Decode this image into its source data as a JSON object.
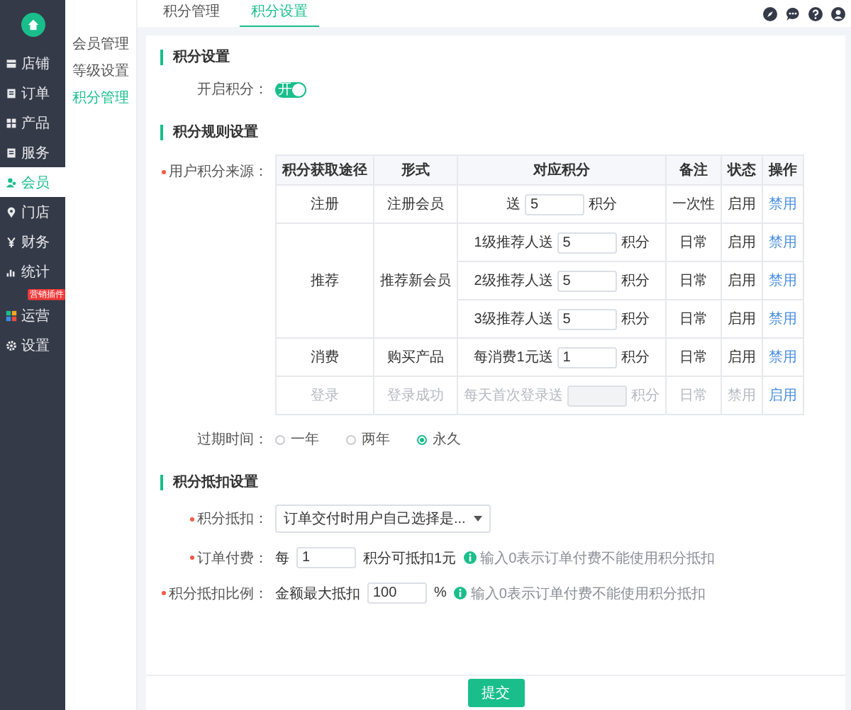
{
  "sidebar": {
    "items": [
      {
        "label": "店铺",
        "selected": false
      },
      {
        "label": "订单",
        "selected": false
      },
      {
        "label": "产品",
        "selected": false
      },
      {
        "label": "服务",
        "selected": false
      },
      {
        "label": "会员",
        "selected": true
      },
      {
        "label": "门店",
        "selected": false
      },
      {
        "label": "财务",
        "selected": false
      },
      {
        "label": "统计",
        "selected": false
      },
      {
        "label": "运营",
        "selected": false,
        "badge": "营销插件"
      },
      {
        "label": "设置",
        "selected": false
      }
    ]
  },
  "subnav": {
    "items": [
      {
        "label": "会员管理",
        "selected": false
      },
      {
        "label": "等级设置",
        "selected": false
      },
      {
        "label": "积分管理",
        "selected": true
      }
    ]
  },
  "tabs": [
    {
      "label": "积分管理",
      "selected": false
    },
    {
      "label": "积分设置",
      "selected": true
    }
  ],
  "sections": [
    {
      "title": "积分设置"
    },
    {
      "title": "积分规则设置"
    },
    {
      "title": "积分抵扣设置"
    }
  ],
  "enable": {
    "label": "开启积分：",
    "on": true,
    "text": "开"
  },
  "rules": {
    "label": "用户积分来源：",
    "required": true,
    "columns": [
      "积分获取途径",
      "形式",
      "对应积分",
      "备注",
      "状态",
      "操作"
    ],
    "groups": [
      {
        "source": "注册",
        "form": "注册会员",
        "disabled": false,
        "items": [
          {
            "prefix": "送",
            "value": "5",
            "unit": "积分",
            "note": "一次性",
            "status": "启用",
            "action": "禁用"
          }
        ]
      },
      {
        "source": "推荐",
        "form": "推荐新会员",
        "disabled": false,
        "items": [
          {
            "prefix": "1级推荐人送",
            "value": "5",
            "unit": "积分",
            "note": "日常",
            "status": "启用",
            "action": "禁用"
          },
          {
            "prefix": "2级推荐人送",
            "value": "5",
            "unit": "积分",
            "note": "日常",
            "status": "启用",
            "action": "禁用"
          },
          {
            "prefix": "3级推荐人送",
            "value": "5",
            "unit": "积分",
            "note": "日常",
            "status": "启用",
            "action": "禁用"
          }
        ]
      },
      {
        "source": "消费",
        "form": "购买产品",
        "disabled": false,
        "items": [
          {
            "prefix": "每消费1元送",
            "value": "1",
            "unit": "积分",
            "note": "日常",
            "status": "启用",
            "action": "禁用"
          }
        ]
      },
      {
        "source": "登录",
        "form": "登录成功",
        "disabled": true,
        "items": [
          {
            "prefix": "每天首次登录送",
            "unit": "积分",
            "note": "日常",
            "status": "禁用",
            "action": "启用"
          }
        ]
      }
    ]
  },
  "expiry": {
    "label": "过期时间：",
    "options": [
      {
        "label": "一年",
        "selected": false
      },
      {
        "label": "两年",
        "selected": false
      },
      {
        "label": "永久",
        "selected": true
      }
    ]
  },
  "deduction": [
    {
      "kind": "select",
      "label": "积分抵扣：",
      "required": true,
      "value": "订单交付时用户自己选择是..."
    },
    {
      "kind": "input",
      "label": "订单付费：",
      "required": true,
      "prefix": "每",
      "value": "1",
      "suffix": "积分可抵扣1元",
      "hint": "输入0表示订单付费不能使用积分抵扣"
    },
    {
      "kind": "input",
      "label": "积分抵扣比例：",
      "required": true,
      "prefix": "金额最大抵扣",
      "value": "100",
      "suffix": "%",
      "hint": "输入0表示订单付费不能使用积分抵扣"
    }
  ],
  "submit": "提交"
}
